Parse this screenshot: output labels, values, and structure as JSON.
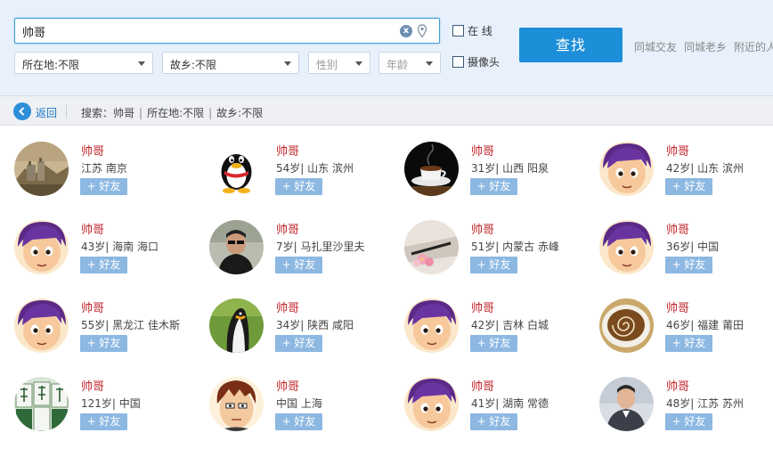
{
  "search": {
    "query": "帅哥",
    "clear_icon": "x",
    "location_label": "所在地:不限",
    "hometown_label": "故乡:不限",
    "gender_placeholder": "性别",
    "age_placeholder": "年龄",
    "online_label": "在  线",
    "camera_label": "摄像头",
    "find_label": "查找",
    "quick_links": [
      "同城交友",
      "同城老乡",
      "附近的人"
    ]
  },
  "crumbs": {
    "back_label": "返回",
    "search_prefix": "搜索：",
    "query": "帅哥",
    "location": "所在地:不限",
    "hometown": "故乡:不限",
    "sep": "|"
  },
  "add_friend_label": "+ 好友",
  "results": [
    {
      "name": "帅哥",
      "info": "江苏 南京",
      "avatar": "castle-photo"
    },
    {
      "name": "帅哥",
      "info": "54岁| 山东 滨州",
      "avatar": "penguin-logo"
    },
    {
      "name": "帅哥",
      "info": "31岁| 山西 阳泉",
      "avatar": "coffee-photo"
    },
    {
      "name": "帅哥",
      "info": "42岁| 山东 滨州",
      "avatar": "cartoon-purple-hair"
    },
    {
      "name": "帅哥",
      "info": "43岁| 海南 海口",
      "avatar": "cartoon-purple-hair"
    },
    {
      "name": "帅哥",
      "info": "7岁| 马扎里沙里夫",
      "avatar": "man-sunglasses-photo"
    },
    {
      "name": "帅哥",
      "info": "51岁| 内蒙古 赤峰",
      "avatar": "flowers-photo"
    },
    {
      "name": "帅哥",
      "info": "36岁| 中国",
      "avatar": "cartoon-purple-hair"
    },
    {
      "name": "帅哥",
      "info": "55岁| 黑龙江 佳木斯",
      "avatar": "cartoon-purple-hair"
    },
    {
      "name": "帅哥",
      "info": "34岁| 陕西 咸阳",
      "avatar": "penguin-photo"
    },
    {
      "name": "帅哥",
      "info": "42岁| 吉林 白城",
      "avatar": "cartoon-purple-hair"
    },
    {
      "name": "帅哥",
      "info": "46岁| 福建 莆田",
      "avatar": "latte-photo"
    },
    {
      "name": "帅哥",
      "info": "121岁| 中国",
      "avatar": "mahjong-photo"
    },
    {
      "name": "帅哥",
      "info": "中国 上海",
      "avatar": "cartoon-brown-hair"
    },
    {
      "name": "帅哥",
      "info": "41岁| 湖南 常德",
      "avatar": "cartoon-purple-hair"
    },
    {
      "name": "帅哥",
      "info": "48岁| 江苏 苏州",
      "avatar": "man-portrait-photo"
    }
  ],
  "colors": {
    "accent": "#1d8ed8",
    "name_red": "#c0272d",
    "add_button": "#8cb8e2",
    "panel_bg": "#e8f1fb"
  }
}
